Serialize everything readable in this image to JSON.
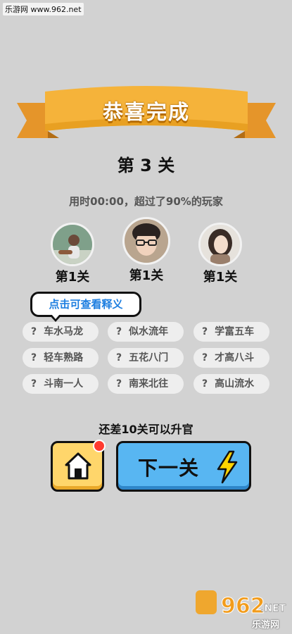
{
  "watermark": "乐游网 www.962.net",
  "banner": {
    "title": "恭喜完成",
    "color": "#f5b33a"
  },
  "level": {
    "title": "第 3 关"
  },
  "time_text": "用时00:00，超过了90%的玩家",
  "players": [
    {
      "level": "第1关"
    },
    {
      "level": "第1关"
    },
    {
      "level": "第1关"
    }
  ],
  "tooltip": "点击可查看释义",
  "idioms": [
    {
      "q": "?",
      "text": "车水马龙"
    },
    {
      "q": "?",
      "text": "似水流年"
    },
    {
      "q": "?",
      "text": "学富五车"
    },
    {
      "q": "?",
      "text": "轻车熟路"
    },
    {
      "q": "?",
      "text": "五花八门"
    },
    {
      "q": "?",
      "text": "才高八斗"
    },
    {
      "q": "?",
      "text": "斗南一人"
    },
    {
      "q": "?",
      "text": "南来北往"
    },
    {
      "q": "?",
      "text": "高山流水"
    }
  ],
  "upgrade_text": "还差10关可以升官",
  "buttons": {
    "home_icon": "home-icon",
    "next_label": "下一关",
    "next_icon": "lightning-icon"
  },
  "brand": {
    "logo_text": "962.NET",
    "caption": "乐游网"
  }
}
